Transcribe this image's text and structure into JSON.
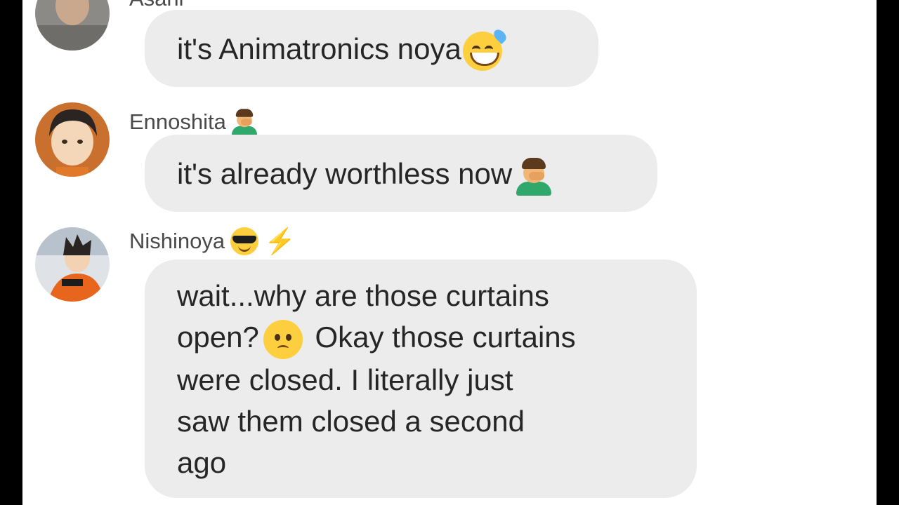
{
  "messages": [
    {
      "sender": "Asahi",
      "text": "it's Animatronics noya",
      "emoji": "grinning-sweat-emoji"
    },
    {
      "sender": "Ennoshita",
      "sender_emoji": "man-facepalming-emoji",
      "text": "it's already worthless now",
      "emoji": "man-facepalming-emoji"
    },
    {
      "sender": "Nishinoya",
      "sender_emoji": [
        "sunglasses-emoji",
        "lightning-emoji"
      ],
      "lines": [
        "wait...why are those curtains",
        "open?",
        " Okay those curtains",
        "were closed. I literally just",
        "saw them closed a second",
        "ago"
      ],
      "emoji": "confused-face-emoji"
    }
  ],
  "colors": {
    "bubble": "#ececec",
    "text": "#262626",
    "sender": "#4a4a4a"
  }
}
